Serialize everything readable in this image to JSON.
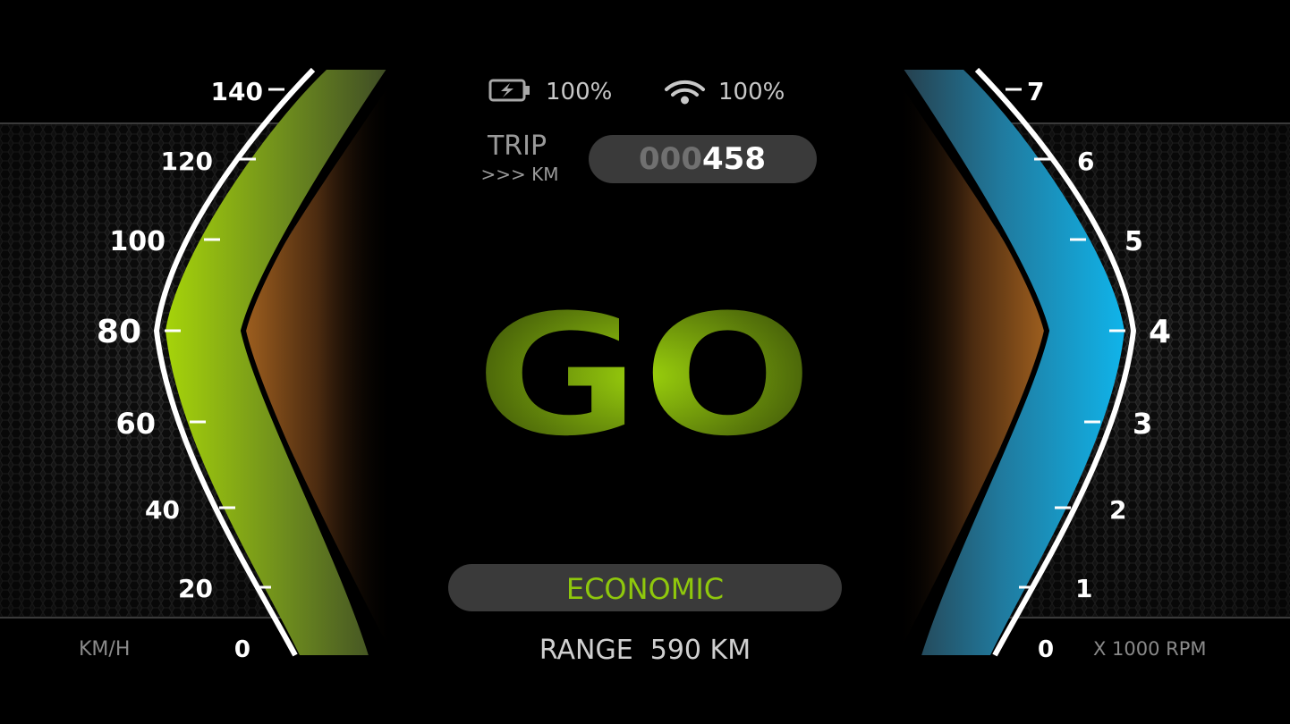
{
  "status": {
    "battery": "100%",
    "wifi": "100%"
  },
  "trip": {
    "label": "TRIP",
    "unit": ">>> KM",
    "odometer_dim": "000",
    "odometer_bright": "458"
  },
  "gear": "GO",
  "mode": "ECONOMIC",
  "range": "RANGE  590 KM",
  "speed_gauge": {
    "unit": "KM/H",
    "ticks": [
      "140",
      "120",
      "100",
      "80",
      "60",
      "40",
      "20",
      "0"
    ]
  },
  "rpm_gauge": {
    "unit": "X 1000 RPM",
    "ticks": [
      "7",
      "6",
      "5",
      "4",
      "3",
      "2",
      "1",
      "0"
    ]
  },
  "colors": {
    "speed_accent": "#9ccc0a",
    "rpm_accent": "#13aee0",
    "gear_text": "#7da50a",
    "mode_text": "#8fc80c",
    "inner_glow": "#9a5a1e"
  }
}
